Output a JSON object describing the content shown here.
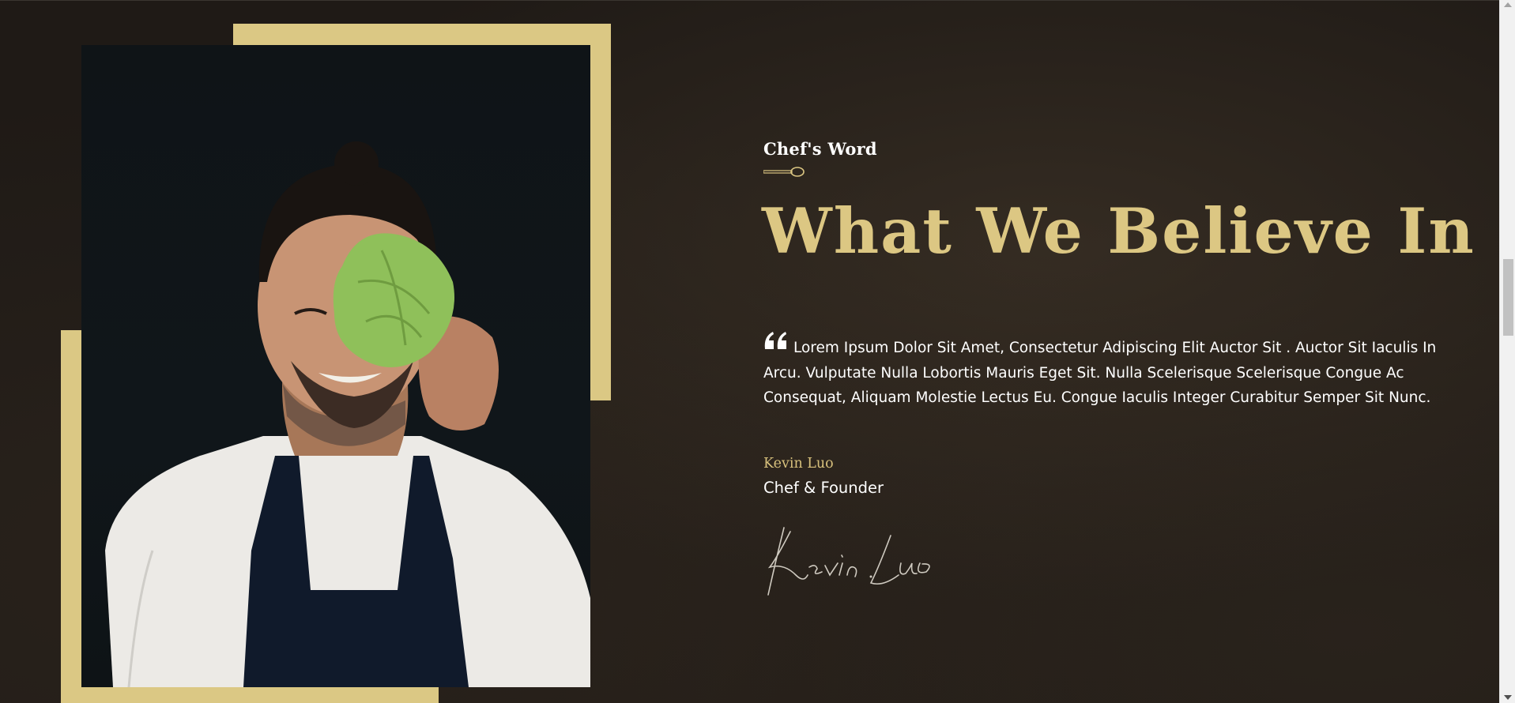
{
  "section": {
    "eyebrow": "Chef's Word",
    "headline": "What We Believe In",
    "quote": "Lorem Ipsum Dolor Sit Amet, Consectetur Adipiscing Elit Auctor Sit . Auctor Sit Iaculis In Arcu. Vulputate Nulla Lobortis Mauris Eget Sit. Nulla Scelerisque Scelerisque Congue Ac Consequat, Aliquam Molestie Lectus Eu. Congue Iaculis Integer Curabitur Semper Sit Nunc.",
    "author_name": "Kevin Luo",
    "author_role": "Chef & Founder",
    "signature": "Kevin Luo"
  },
  "icons": {
    "quote": "quote-icon",
    "spoon": "spoon-divider-icon"
  },
  "colors": {
    "accent": "#dcc783",
    "frame": "#dbc884",
    "background": "#1f1a16",
    "text": "#ffffff"
  }
}
